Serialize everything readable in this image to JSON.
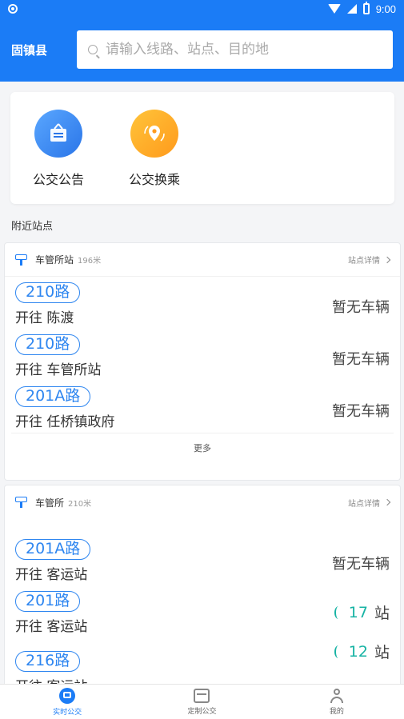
{
  "status_bar": {
    "time": "9:00"
  },
  "header": {
    "city": "固镇县",
    "search_placeholder": "请输入线路、站点、目的地"
  },
  "quick_actions": [
    {
      "label": "公交公告",
      "icon": "notice-board-icon",
      "color": "#3b8cf5"
    },
    {
      "label": "公交换乘",
      "icon": "transfer-location-icon",
      "color": "#ffb02e"
    }
  ],
  "section_title": "附近站点",
  "stations": [
    {
      "name": "车管所站",
      "distance": "196米",
      "detail_label": "站点详情",
      "routes": [
        {
          "line": "210路",
          "direction": "开往 陈渡",
          "status": "暂无车辆"
        },
        {
          "line": "210路",
          "direction": "开往 车管所站",
          "status": "暂无车辆"
        },
        {
          "line": "201A路",
          "direction": "开往 任桥镇政府",
          "status": "暂无车辆"
        }
      ],
      "more_label": "更多"
    },
    {
      "name": "车管所",
      "distance": "210米",
      "detail_label": "站点详情",
      "routes": [
        {
          "line": "201A路",
          "direction": "开往 客运站",
          "status": "暂无车辆"
        },
        {
          "line": "201路",
          "direction": "开往 客运站",
          "eta": "17",
          "eta_unit": "站"
        },
        {
          "line": "216路",
          "direction": "开往 客运站",
          "eta": "12",
          "eta_unit": "站"
        }
      ]
    }
  ],
  "bottom_nav": [
    {
      "label": "实时公交",
      "active": true
    },
    {
      "label": "定制公交",
      "active": false
    },
    {
      "label": "我的",
      "active": false
    }
  ],
  "colors": {
    "primary": "#1b7cf6",
    "eta": "#17b3a4"
  }
}
